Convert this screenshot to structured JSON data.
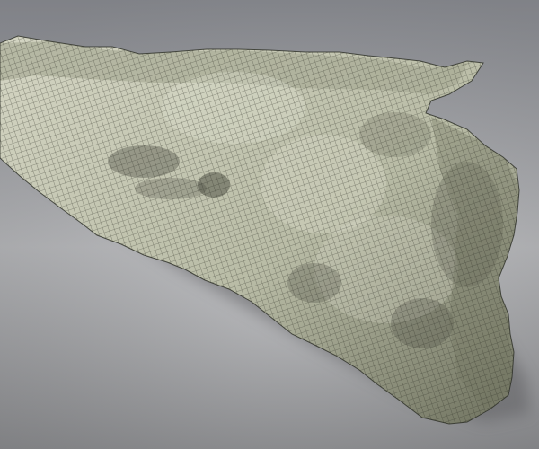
{
  "scene": {
    "subject": "rock-cliff-wireframe-mesh",
    "colors": {
      "background_top": "#8e9096",
      "background_mid": "#b7b8bb",
      "background_bottom": "#8b8c8f",
      "mesh_fill_light": "#d4d5c3",
      "mesh_fill_mid": "#b9bca6",
      "mesh_fill_shadow": "#6f725f",
      "mesh_fill_dark": "#3b3d33",
      "wire": "#2b2d24",
      "ground_shadow": "#5e5f62"
    }
  }
}
